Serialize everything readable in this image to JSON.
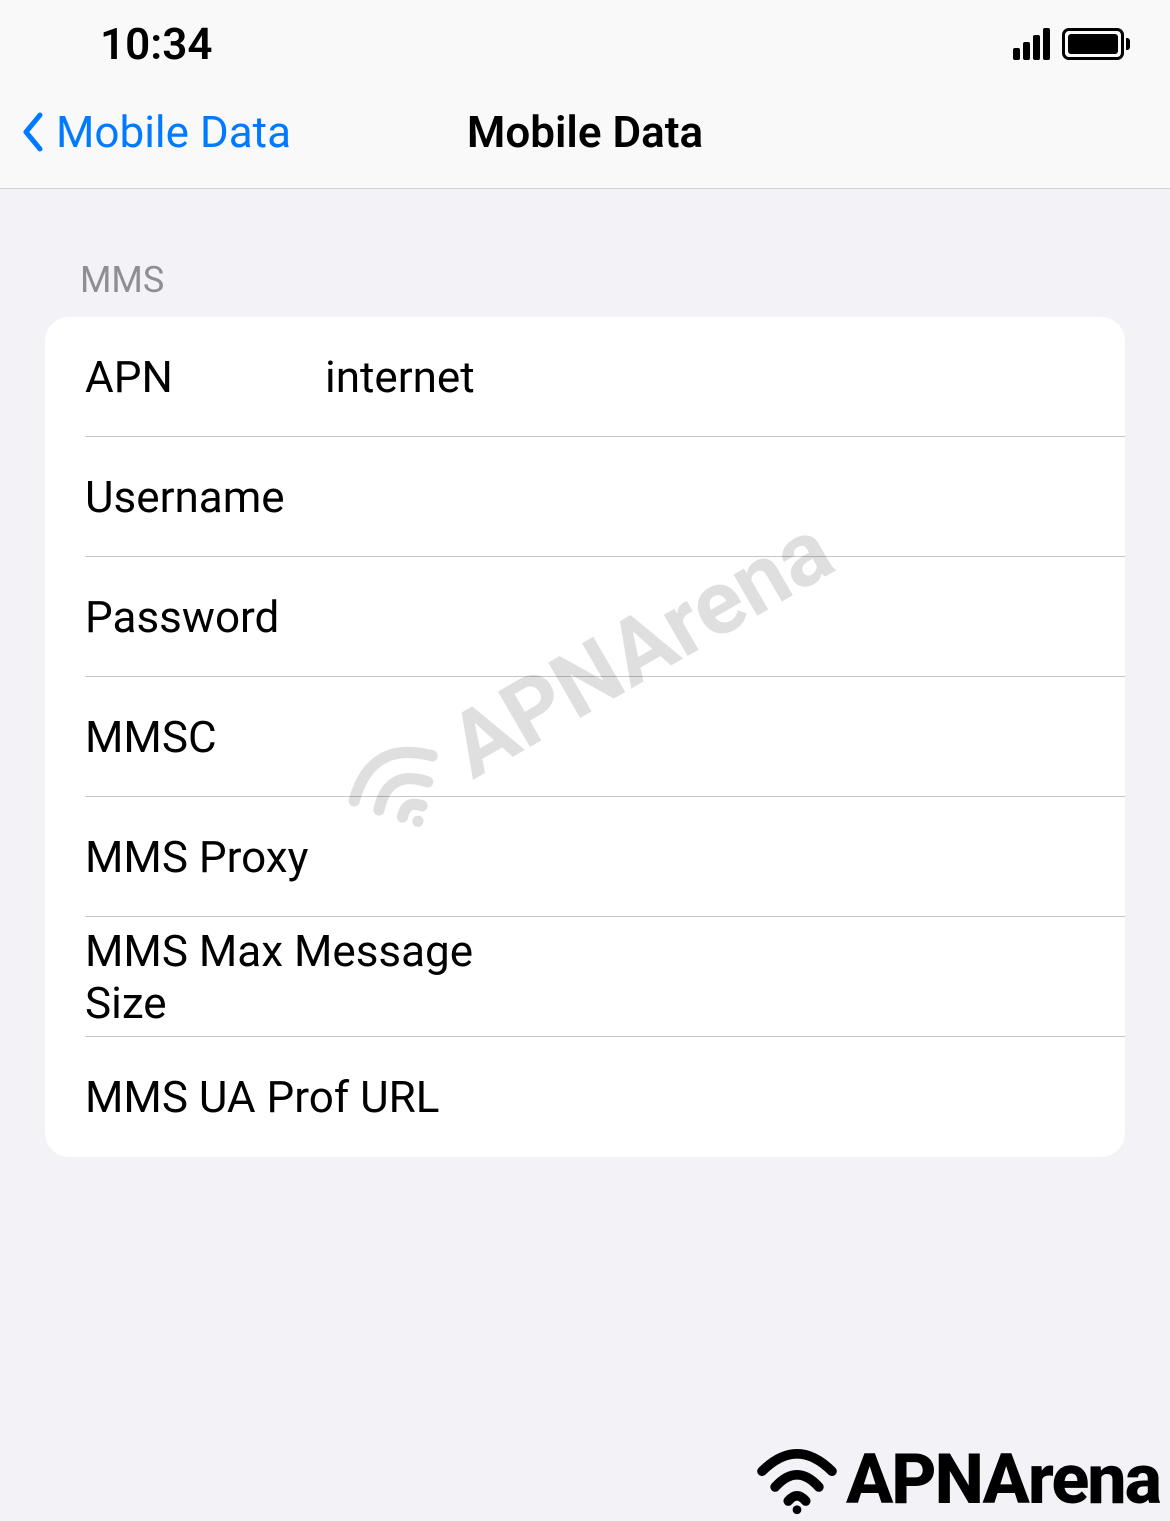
{
  "status": {
    "time": "10:34"
  },
  "nav": {
    "back_label": "Mobile Data",
    "title": "Mobile Data"
  },
  "section": {
    "header": "MMS"
  },
  "fields": {
    "apn": {
      "label": "APN",
      "value": "internet"
    },
    "username": {
      "label": "Username",
      "value": ""
    },
    "password": {
      "label": "Password",
      "value": ""
    },
    "mmsc": {
      "label": "MMSC",
      "value": ""
    },
    "mms_proxy": {
      "label": "MMS Proxy",
      "value": ""
    },
    "mms_max_size": {
      "label": "MMS Max Message Size",
      "value": ""
    },
    "mms_ua_prof_url": {
      "label": "MMS UA Prof URL",
      "value": ""
    }
  },
  "watermark": {
    "text": "APNArena"
  },
  "brand": {
    "text": "APNArena"
  }
}
